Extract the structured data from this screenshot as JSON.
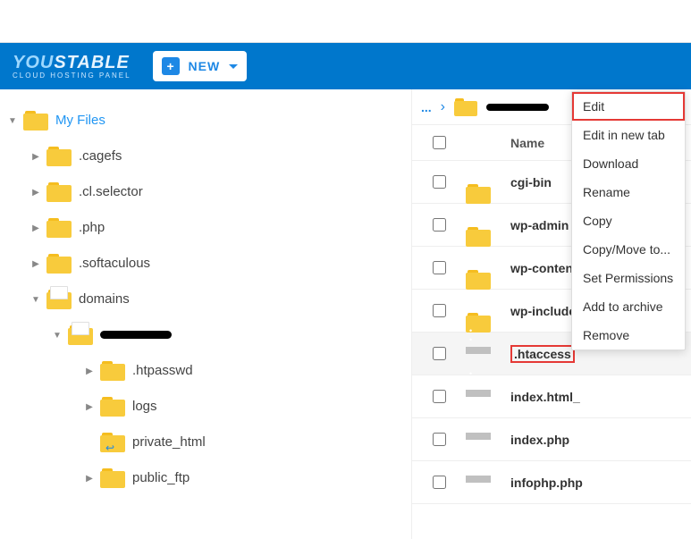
{
  "header": {
    "logo_you": "YOU",
    "logo_stable": "STABLE",
    "logo_sub": "CLOUD HOSTING PANEL",
    "new_label": "NEW"
  },
  "sidebar": {
    "root": "My Files",
    "items": [
      {
        "label": ".cagefs"
      },
      {
        "label": ".cl.selector"
      },
      {
        "label": ".php"
      },
      {
        "label": ".softaculous"
      },
      {
        "label": "domains"
      }
    ],
    "domain_children": [
      {
        "label": ".htpasswd"
      },
      {
        "label": "logs"
      },
      {
        "label": "private_html"
      },
      {
        "label": "public_ftp"
      }
    ]
  },
  "breadcrumb": {
    "ellipsis": "..."
  },
  "table": {
    "name_header": "Name",
    "rows": [
      {
        "name": "cgi-bin",
        "type": "folder"
      },
      {
        "name": "wp-admin",
        "type": "folder"
      },
      {
        "name": "wp-content",
        "type": "folder"
      },
      {
        "name": "wp-include",
        "type": "folder"
      },
      {
        "name": ".htaccess",
        "type": "file",
        "highlight": true
      },
      {
        "name": "index.html_",
        "type": "file"
      },
      {
        "name": "index.php",
        "type": "file"
      },
      {
        "name": "infophp.php",
        "type": "file"
      }
    ]
  },
  "context_menu": {
    "items": [
      "Edit",
      "Edit in new tab",
      "Download",
      "Rename",
      "Copy",
      "Copy/Move to...",
      "Set Permissions",
      "Add to archive",
      "Remove"
    ]
  }
}
